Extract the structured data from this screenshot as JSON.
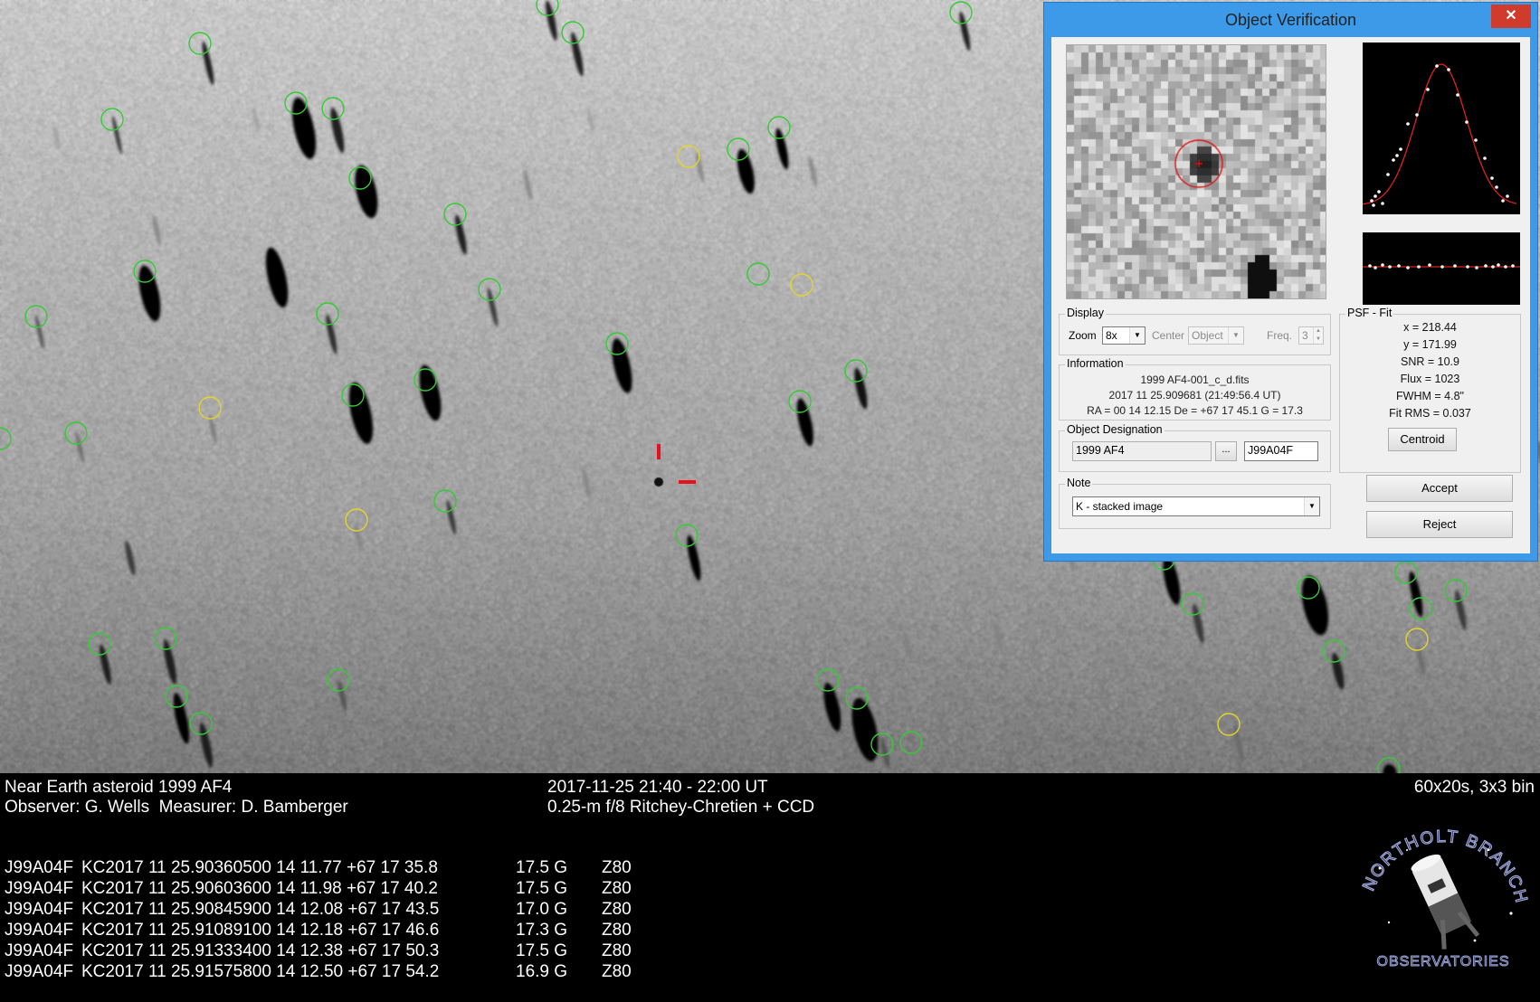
{
  "image": {
    "target_marker_color": "#e8101e",
    "known_object_circle_color": "#33cc33",
    "other_object_circle_color": "#e4d52a"
  },
  "caption": {
    "object": "Near Earth asteroid 1999 AF4",
    "credits": "Observer: G. Wells  Measurer: D. Bamberger",
    "date_range": "2017-11-25 21:40 - 22:00 UT",
    "telescope": "0.25-m f/8 Ritchey-Chretien + CCD",
    "exposure": "60x20s, 3x3 bin"
  },
  "observations": [
    {
      "desig": "J99A04F",
      "obs": "KC2017 11 25.90360500 14 11.77 +67 17 35.8",
      "mag": "17.5 G",
      "code": "Z80"
    },
    {
      "desig": "J99A04F",
      "obs": "KC2017 11 25.90603600 14 11.98 +67 17 40.2",
      "mag": "17.5 G",
      "code": "Z80"
    },
    {
      "desig": "J99A04F",
      "obs": "KC2017 11 25.90845900 14 12.08 +67 17 43.5",
      "mag": "17.0 G",
      "code": "Z80"
    },
    {
      "desig": "J99A04F",
      "obs": "KC2017 11 25.91089100 14 12.18 +67 17 46.6",
      "mag": "17.3 G",
      "code": "Z80"
    },
    {
      "desig": "J99A04F",
      "obs": "KC2017 11 25.91333400 14 12.38 +67 17 50.3",
      "mag": "17.5 G",
      "code": "Z80"
    },
    {
      "desig": "J99A04F",
      "obs": "KC2017 11 25.91575800 14 12.50 +67 17 54.2",
      "mag": "16.9 G",
      "code": "Z80"
    }
  ],
  "logo": {
    "top_text": "NORTHOLT BRANCH",
    "bottom_text": "OBSERVATORIES"
  },
  "dialog": {
    "title": "Object Verification",
    "close_label": "✕",
    "display": {
      "group_title": "Display",
      "zoom_label": "Zoom",
      "zoom_value": "8x",
      "center_label": "Center",
      "center_value": "Object",
      "freq_label": "Freq.",
      "freq_value": "3"
    },
    "information": {
      "group_title": "Information",
      "filename": "1999 AF4-001_c_d.fits",
      "datetime": "2017 11 25.909681 (21:49:56.4 UT)",
      "coords": "RA = 00 14 12.15   De = +67 17 45.1   G = 17.3"
    },
    "designation": {
      "group_title": "Object Designation",
      "name": "1999 AF4",
      "browse_label": "...",
      "packed": "J99A04F"
    },
    "note": {
      "group_title": "Note",
      "value": "K - stacked image"
    },
    "psf": {
      "group_title": "PSF - Fit",
      "x": "x = 218.44",
      "y": "y = 171.99",
      "snr": "SNR = 10.9",
      "flux": "Flux = 1023",
      "fwhm": "FWHM = 4.8\"",
      "fit_rms": "Fit RMS = 0.037",
      "centroid_label": "Centroid"
    },
    "accept_label": "Accept",
    "reject_label": "Reject"
  }
}
